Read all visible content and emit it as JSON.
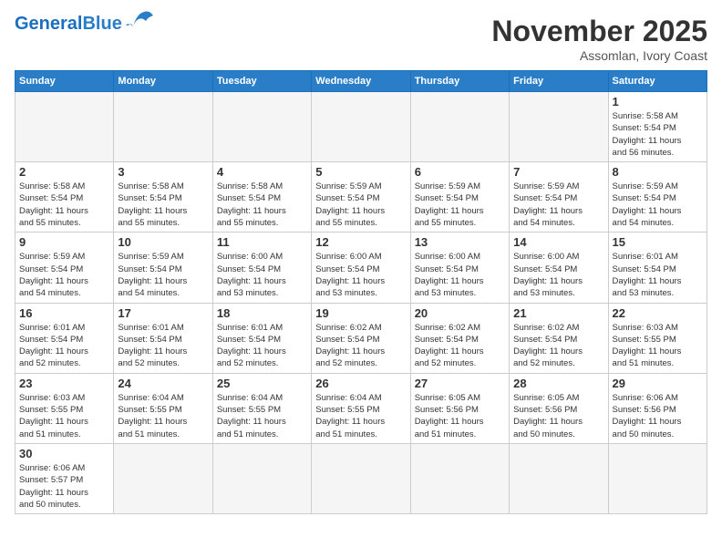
{
  "header": {
    "logo_general": "General",
    "logo_blue": "Blue",
    "month_title": "November 2025",
    "location": "Assomlan, Ivory Coast"
  },
  "weekdays": [
    "Sunday",
    "Monday",
    "Tuesday",
    "Wednesday",
    "Thursday",
    "Friday",
    "Saturday"
  ],
  "weeks": [
    [
      {
        "day": "",
        "info": ""
      },
      {
        "day": "",
        "info": ""
      },
      {
        "day": "",
        "info": ""
      },
      {
        "day": "",
        "info": ""
      },
      {
        "day": "",
        "info": ""
      },
      {
        "day": "",
        "info": ""
      },
      {
        "day": "1",
        "info": "Sunrise: 5:58 AM\nSunset: 5:54 PM\nDaylight: 11 hours\nand 56 minutes."
      }
    ],
    [
      {
        "day": "2",
        "info": "Sunrise: 5:58 AM\nSunset: 5:54 PM\nDaylight: 11 hours\nand 55 minutes."
      },
      {
        "day": "3",
        "info": "Sunrise: 5:58 AM\nSunset: 5:54 PM\nDaylight: 11 hours\nand 55 minutes."
      },
      {
        "day": "4",
        "info": "Sunrise: 5:58 AM\nSunset: 5:54 PM\nDaylight: 11 hours\nand 55 minutes."
      },
      {
        "day": "5",
        "info": "Sunrise: 5:59 AM\nSunset: 5:54 PM\nDaylight: 11 hours\nand 55 minutes."
      },
      {
        "day": "6",
        "info": "Sunrise: 5:59 AM\nSunset: 5:54 PM\nDaylight: 11 hours\nand 55 minutes."
      },
      {
        "day": "7",
        "info": "Sunrise: 5:59 AM\nSunset: 5:54 PM\nDaylight: 11 hours\nand 54 minutes."
      },
      {
        "day": "8",
        "info": "Sunrise: 5:59 AM\nSunset: 5:54 PM\nDaylight: 11 hours\nand 54 minutes."
      }
    ],
    [
      {
        "day": "9",
        "info": "Sunrise: 5:59 AM\nSunset: 5:54 PM\nDaylight: 11 hours\nand 54 minutes."
      },
      {
        "day": "10",
        "info": "Sunrise: 5:59 AM\nSunset: 5:54 PM\nDaylight: 11 hours\nand 54 minutes."
      },
      {
        "day": "11",
        "info": "Sunrise: 6:00 AM\nSunset: 5:54 PM\nDaylight: 11 hours\nand 53 minutes."
      },
      {
        "day": "12",
        "info": "Sunrise: 6:00 AM\nSunset: 5:54 PM\nDaylight: 11 hours\nand 53 minutes."
      },
      {
        "day": "13",
        "info": "Sunrise: 6:00 AM\nSunset: 5:54 PM\nDaylight: 11 hours\nand 53 minutes."
      },
      {
        "day": "14",
        "info": "Sunrise: 6:00 AM\nSunset: 5:54 PM\nDaylight: 11 hours\nand 53 minutes."
      },
      {
        "day": "15",
        "info": "Sunrise: 6:01 AM\nSunset: 5:54 PM\nDaylight: 11 hours\nand 53 minutes."
      }
    ],
    [
      {
        "day": "16",
        "info": "Sunrise: 6:01 AM\nSunset: 5:54 PM\nDaylight: 11 hours\nand 52 minutes."
      },
      {
        "day": "17",
        "info": "Sunrise: 6:01 AM\nSunset: 5:54 PM\nDaylight: 11 hours\nand 52 minutes."
      },
      {
        "day": "18",
        "info": "Sunrise: 6:01 AM\nSunset: 5:54 PM\nDaylight: 11 hours\nand 52 minutes."
      },
      {
        "day": "19",
        "info": "Sunrise: 6:02 AM\nSunset: 5:54 PM\nDaylight: 11 hours\nand 52 minutes."
      },
      {
        "day": "20",
        "info": "Sunrise: 6:02 AM\nSunset: 5:54 PM\nDaylight: 11 hours\nand 52 minutes."
      },
      {
        "day": "21",
        "info": "Sunrise: 6:02 AM\nSunset: 5:54 PM\nDaylight: 11 hours\nand 52 minutes."
      },
      {
        "day": "22",
        "info": "Sunrise: 6:03 AM\nSunset: 5:55 PM\nDaylight: 11 hours\nand 51 minutes."
      }
    ],
    [
      {
        "day": "23",
        "info": "Sunrise: 6:03 AM\nSunset: 5:55 PM\nDaylight: 11 hours\nand 51 minutes."
      },
      {
        "day": "24",
        "info": "Sunrise: 6:04 AM\nSunset: 5:55 PM\nDaylight: 11 hours\nand 51 minutes."
      },
      {
        "day": "25",
        "info": "Sunrise: 6:04 AM\nSunset: 5:55 PM\nDaylight: 11 hours\nand 51 minutes."
      },
      {
        "day": "26",
        "info": "Sunrise: 6:04 AM\nSunset: 5:55 PM\nDaylight: 11 hours\nand 51 minutes."
      },
      {
        "day": "27",
        "info": "Sunrise: 6:05 AM\nSunset: 5:56 PM\nDaylight: 11 hours\nand 51 minutes."
      },
      {
        "day": "28",
        "info": "Sunrise: 6:05 AM\nSunset: 5:56 PM\nDaylight: 11 hours\nand 50 minutes."
      },
      {
        "day": "29",
        "info": "Sunrise: 6:06 AM\nSunset: 5:56 PM\nDaylight: 11 hours\nand 50 minutes."
      }
    ],
    [
      {
        "day": "30",
        "info": "Sunrise: 6:06 AM\nSunset: 5:57 PM\nDaylight: 11 hours\nand 50 minutes."
      },
      {
        "day": "",
        "info": ""
      },
      {
        "day": "",
        "info": ""
      },
      {
        "day": "",
        "info": ""
      },
      {
        "day": "",
        "info": ""
      },
      {
        "day": "",
        "info": ""
      },
      {
        "day": "",
        "info": ""
      }
    ]
  ]
}
